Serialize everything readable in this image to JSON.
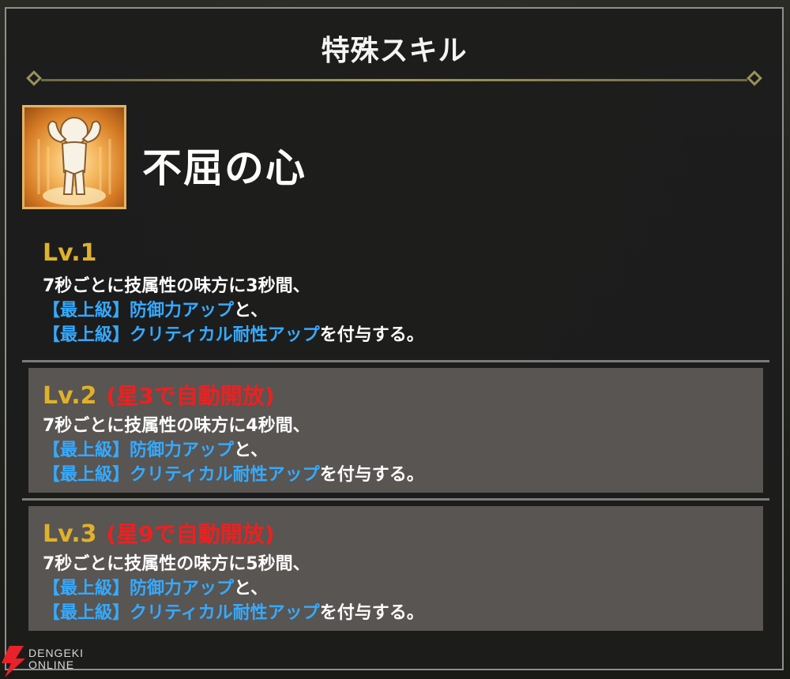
{
  "panel": {
    "title": "特殊スキル"
  },
  "skill": {
    "icon": "flexing-figure-icon",
    "name": "不屈の心"
  },
  "levels": [
    {
      "label": "Lv.1",
      "unlock": "",
      "line1": "7秒ごとに技属性の味方に3秒間、",
      "line2_blue": "【最上級】防御力アップ",
      "line2_rest": "と、",
      "line3_blue": "【最上級】クリティカル耐性アップ",
      "line3_rest": "を付与する。"
    },
    {
      "label": "Lv.2",
      "unlock": "(星3で自動開放)",
      "line1": "7秒ごとに技属性の味方に4秒間、",
      "line2_blue": "【最上級】防御力アップ",
      "line2_rest": "と、",
      "line3_blue": "【最上級】クリティカル耐性アップ",
      "line3_rest": "を付与する。"
    },
    {
      "label": "Lv.3",
      "unlock": "(星9で自動開放)",
      "line1": "7秒ごとに技属性の味方に5秒間、",
      "line2_blue": "【最上級】防御力アップ",
      "line2_rest": "と、",
      "line3_blue": "【最上級】クリティカル耐性アップ",
      "line3_rest": "を付与する。"
    }
  ],
  "watermark": {
    "line1": "DENGEKI",
    "line2": "ONLINE"
  },
  "colors": {
    "level_label": "#e0b12a",
    "unlock_text": "#f01f1f",
    "buff_text": "#35aaff",
    "locked_box": "#585553"
  }
}
